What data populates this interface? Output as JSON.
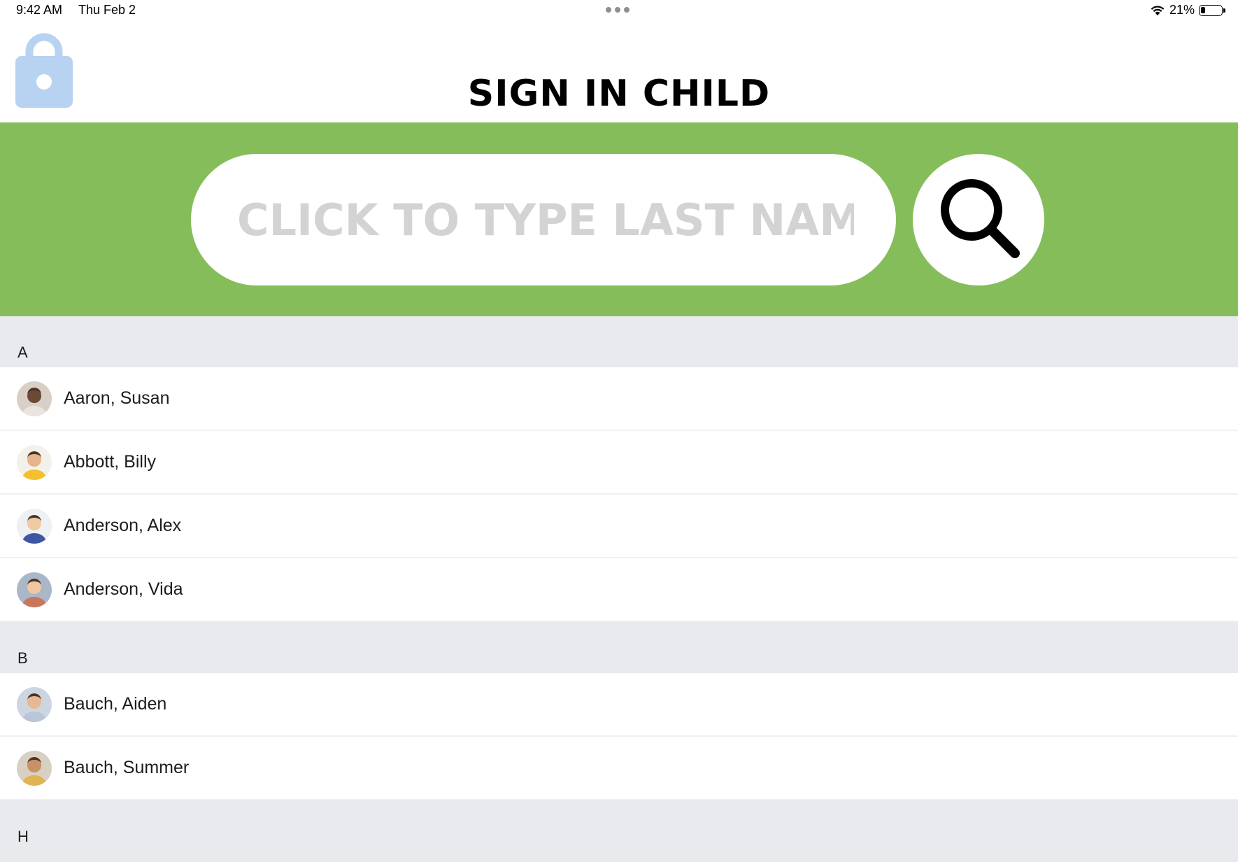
{
  "status_bar": {
    "time": "9:42 AM",
    "date": "Thu Feb 2",
    "battery_percent_label": "21%",
    "battery_level": 0.21
  },
  "header": {
    "title": "SIGN IN CHILD",
    "lock_icon": "unlocked-padlock-icon"
  },
  "search": {
    "placeholder": "CLICK TO TYPE LAST NAME",
    "value": "",
    "button_icon": "search-icon"
  },
  "colors": {
    "band": "#85bd5a",
    "lock": "#b8d2f1",
    "section_bg": "#e9eaee"
  },
  "sections": [
    {
      "letter": "A",
      "children": [
        {
          "name": "Aaron, Susan"
        },
        {
          "name": "Abbott, Billy"
        },
        {
          "name": "Anderson, Alex"
        },
        {
          "name": "Anderson, Vida"
        }
      ]
    },
    {
      "letter": "B",
      "children": [
        {
          "name": "Bauch, Aiden"
        },
        {
          "name": "Bauch, Summer"
        }
      ]
    },
    {
      "letter": "H",
      "children": []
    }
  ]
}
